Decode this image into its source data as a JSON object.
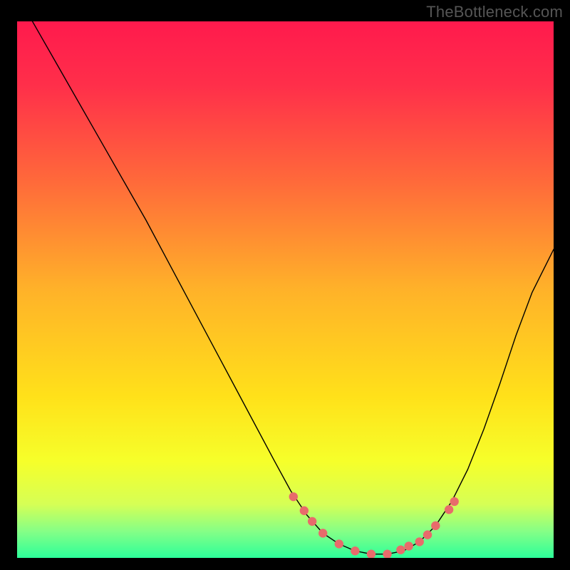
{
  "watermark": "TheBottleneck.com",
  "chart_data": {
    "type": "line",
    "title": "",
    "xlabel": "",
    "ylabel": "",
    "xlim": [
      0,
      100
    ],
    "ylim": [
      0,
      100
    ],
    "grid": false,
    "legend": false,
    "background": {
      "gradient_stops": [
        {
          "pos": 0.0,
          "color": "#ff1a4d"
        },
        {
          "pos": 0.12,
          "color": "#ff2f4a"
        },
        {
          "pos": 0.3,
          "color": "#ff6a3a"
        },
        {
          "pos": 0.5,
          "color": "#ffb229"
        },
        {
          "pos": 0.7,
          "color": "#ffe11a"
        },
        {
          "pos": 0.82,
          "color": "#f6ff2a"
        },
        {
          "pos": 0.9,
          "color": "#d6ff55"
        },
        {
          "pos": 0.95,
          "color": "#86ff86"
        },
        {
          "pos": 1.0,
          "color": "#2cff9a"
        }
      ]
    },
    "series": [
      {
        "name": "bottleneck-curve",
        "type": "line",
        "color": "#000000",
        "width": 1.4,
        "x": [
          0,
          4,
          8,
          12,
          16,
          20,
          24,
          28,
          32,
          36,
          40,
          44,
          48,
          51,
          54,
          57,
          60,
          63,
          66,
          69,
          72,
          75,
          78,
          81,
          84,
          87,
          90,
          93,
          96,
          100
        ],
        "y": [
          105,
          98,
          91,
          84,
          77,
          70,
          63,
          55.5,
          48,
          40.5,
          33,
          25.5,
          18,
          12.5,
          8,
          4.6,
          2.6,
          1.3,
          0.7,
          0.7,
          1.3,
          3.0,
          6.0,
          10.5,
          16.5,
          24.0,
          32.5,
          41.5,
          49.5,
          57.5
        ]
      },
      {
        "name": "markers",
        "type": "scatter",
        "color": "#e86b6b",
        "radius": 6.2,
        "x": [
          51.5,
          53.5,
          55.0,
          57.0,
          60.0,
          63.0,
          66.0,
          69.0,
          71.5,
          73.0,
          75.0,
          76.5,
          78.0,
          80.5,
          81.5
        ],
        "y": [
          11.4,
          8.8,
          6.8,
          4.6,
          2.6,
          1.3,
          0.7,
          0.7,
          1.5,
          2.2,
          3.0,
          4.3,
          6.0,
          9.0,
          10.5
        ]
      }
    ]
  }
}
